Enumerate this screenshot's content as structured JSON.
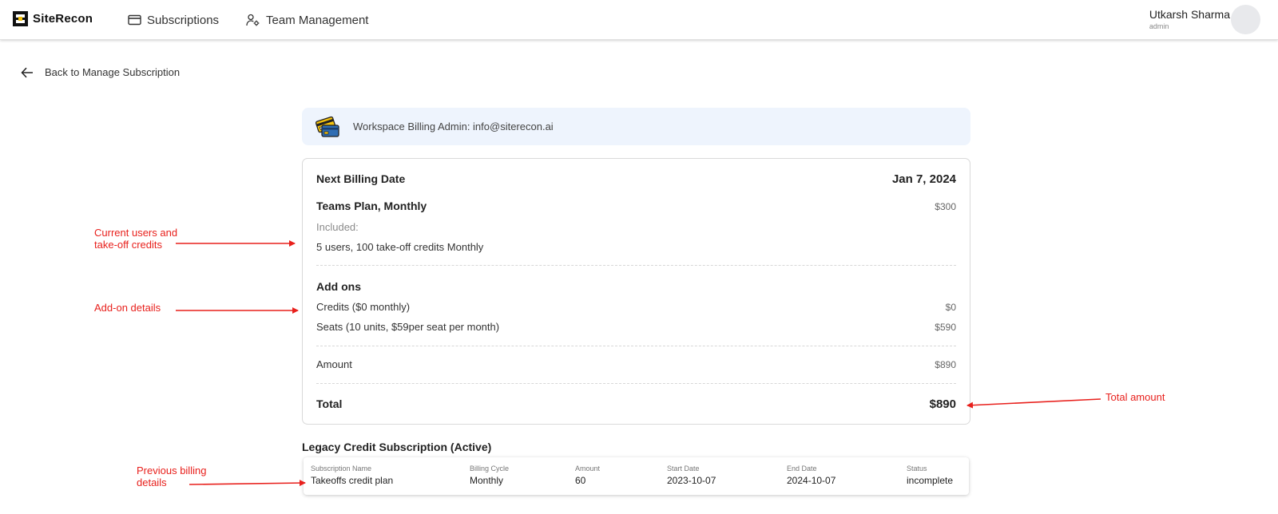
{
  "header": {
    "brand": "SiteRecon",
    "nav": [
      {
        "label": "Subscriptions",
        "icon": "credit-card-icon"
      },
      {
        "label": "Team Management",
        "icon": "team-settings-icon"
      }
    ],
    "user": {
      "name": "Utkarsh Sharma",
      "role": "admin"
    }
  },
  "back_link": {
    "label": "Back to Manage Subscription",
    "icon": "arrow-left-icon"
  },
  "banner": {
    "text": "Workspace Billing Admin: info@siterecon.ai",
    "icon": "credit-cards-icon"
  },
  "billing": {
    "next_billing_label": "Next Billing Date",
    "next_billing_date": "Jan 7, 2024",
    "plan_name": "Teams Plan, Monthly",
    "plan_price": "$300",
    "included_label": "Included:",
    "included_text": "5 users, 100 take-off credits Monthly",
    "addons_title": "Add ons",
    "addons": [
      {
        "label": "Credits ($0 monthly)",
        "value": "$0"
      },
      {
        "label": "Seats (10 units, $59per seat per month)",
        "value": "$590"
      }
    ],
    "amount_label": "Amount",
    "amount_value": "$890",
    "total_label": "Total",
    "total_value": "$890"
  },
  "legacy": {
    "title": "Legacy Credit Subscription (Active)",
    "columns": [
      {
        "header": "Subscription Name",
        "value": "Takeoffs credit plan"
      },
      {
        "header": "Billing Cycle",
        "value": "Monthly"
      },
      {
        "header": "Amount",
        "value": "60"
      },
      {
        "header": "Start Date",
        "value": "2023-10-07"
      },
      {
        "header": "End Date",
        "value": "2024-10-07"
      },
      {
        "header": "Status",
        "value": "incomplete"
      }
    ]
  },
  "annotations": {
    "current_users": [
      "Current users and",
      "take-off credits"
    ],
    "addon_details": "Add-on details",
    "total_amount": "Total amount",
    "previous_billing": [
      "Previous billing",
      "details"
    ],
    "color": "#e8201c"
  },
  "colors": {
    "banner_bg": "#eef4fd",
    "brand_yellow": "#f4c20d"
  }
}
